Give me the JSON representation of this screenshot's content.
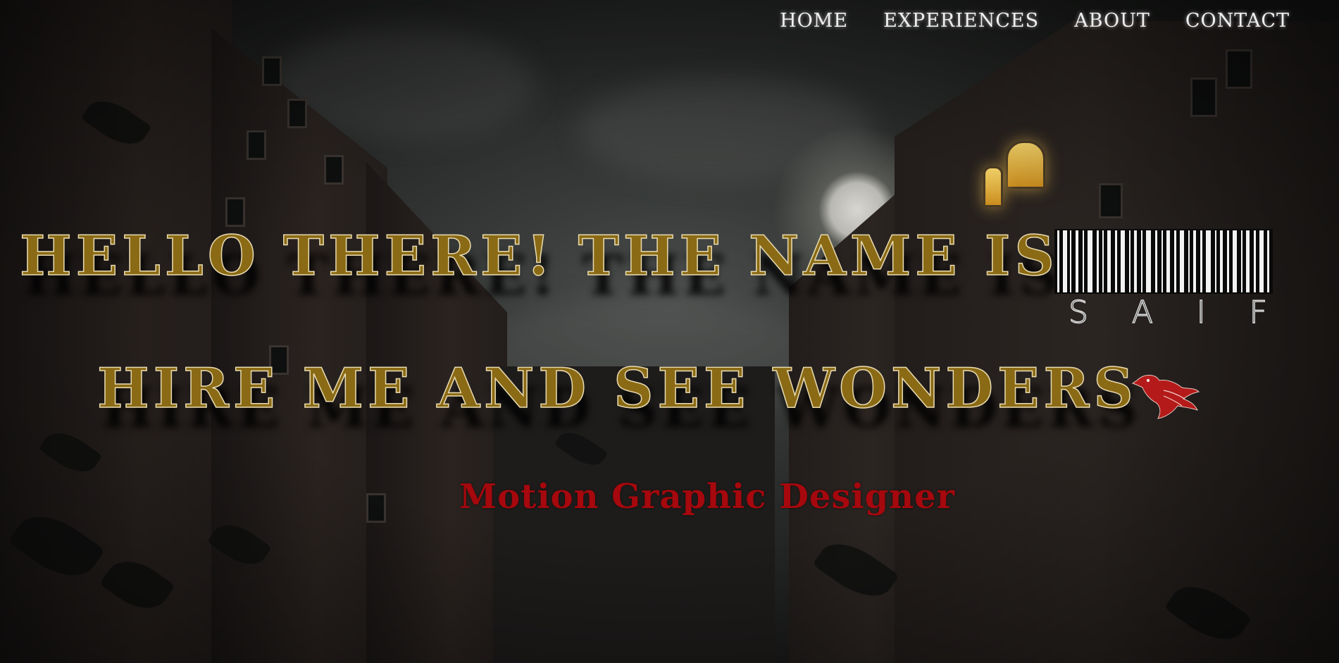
{
  "nav": {
    "items": [
      "HOME",
      "EXPERIENCES",
      "ABOUT",
      "CONTACT"
    ]
  },
  "hero": {
    "line1": "HELLO THERE! THE NAME IS",
    "barcode_name": [
      "S",
      "A",
      "I",
      "F"
    ],
    "line2": "HIRE ME AND SEE WONDERS",
    "subtitle": "Motion Graphic Designer"
  },
  "icons": {
    "phoenix": "phoenix-icon",
    "barcode": "barcode-icon"
  },
  "colors": {
    "headline_fill": "#8a6a14",
    "headline_stroke": "#e9dbb0",
    "subtitle": "#a5080d",
    "nav_text": "#efefef",
    "phoenix": "#b51a1a"
  }
}
